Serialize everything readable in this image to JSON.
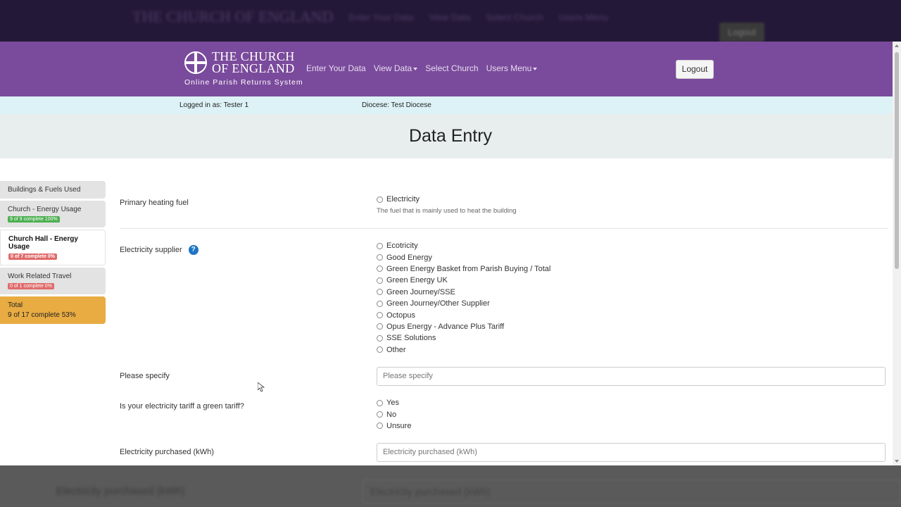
{
  "background": {
    "ghost_brand": "THE CHURCH OF ENGLAND",
    "ghost_nav": [
      "Enter Your Data",
      "View Data",
      "Select Church",
      "Users Menu"
    ],
    "ghost_logout": "Logout",
    "ghost_label": "Electricity purchased (kWh)",
    "ghost_input": "Electricity purchased (kWh)"
  },
  "brand": {
    "line1": "THE CHURCH",
    "line2": "OF ENGLAND",
    "subtitle": "Online Parish Returns System",
    "color": "#7a4a9c"
  },
  "nav": {
    "enter_data": "Enter Your Data",
    "view_data": "View Data",
    "select_church": "Select Church",
    "users_menu": "Users Menu",
    "logout": "Logout"
  },
  "info": {
    "logged_in": "Logged in as: Tester 1",
    "diocese": "Diocese: Test Diocese"
  },
  "page_title": "Data Entry",
  "sidebar": {
    "items": [
      {
        "label": "Buildings & Fuels Used",
        "badge": ""
      },
      {
        "label": "Church - Energy Usage",
        "badge": "9 of 9 complete 100%",
        "badge_color": "green"
      },
      {
        "label": "Church Hall - Energy Usage",
        "badge": "0 of 7 complete 0%",
        "badge_color": "red",
        "active": true
      },
      {
        "label": "Work Related Travel",
        "badge": "0 of 1 complete 0%",
        "badge_color": "red"
      }
    ],
    "total_label": "Total",
    "total_value": "9 of 17 complete 53%"
  },
  "form": {
    "heating": {
      "label": "Primary heating fuel",
      "options": [
        "Electricity"
      ],
      "help": "The fuel that is mainly used to heat the building"
    },
    "supplier": {
      "label": "Electricity supplier",
      "help_icon": "?",
      "options": [
        "Ecotricity",
        "Good Energy",
        "Green Energy Basket from Parish Buying / Total",
        "Green Energy UK",
        "Green Journey/SSE",
        "Green Journey/Other Supplier",
        "Octopus",
        "Opus Energy - Advance Plus Tariff",
        "SSE Solutions",
        "Other"
      ]
    },
    "specify": {
      "label": "Please specify",
      "placeholder": "Please specify"
    },
    "green_tariff": {
      "label": "Is your electricity tariff a green tariff?",
      "options": [
        "Yes",
        "No",
        "Unsure"
      ]
    },
    "purchased": {
      "label": "Electricity purchased (kWh)",
      "placeholder": "Electricity purchased (kWh)"
    }
  }
}
